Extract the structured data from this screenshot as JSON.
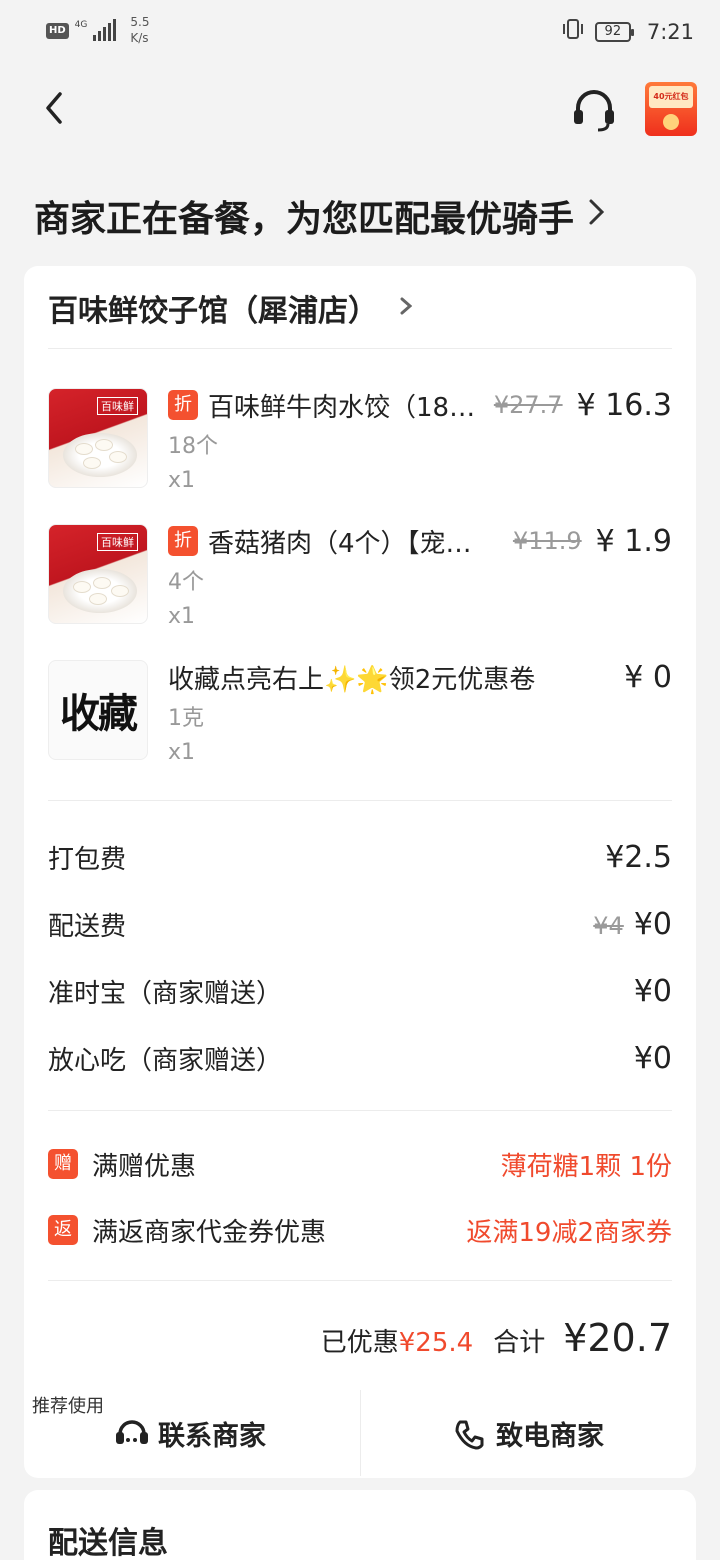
{
  "statusbar": {
    "hd": "HD",
    "network": "4G",
    "speed_value": "5.5",
    "speed_unit": "K/s",
    "battery": "92",
    "time": "7:21"
  },
  "nav": {
    "redpacket_text": "40元红包"
  },
  "order_status": "商家正在备餐，为您匹配最优骑手",
  "shop": {
    "name": "百味鲜饺子馆（犀浦店）"
  },
  "items": [
    {
      "badge": "折",
      "name": "百味鲜牛肉水饺（18…",
      "orig_price": "¥27.7",
      "price": "¥ 16.3",
      "spec": "18个",
      "qty": "x1",
      "thumb_brand": "百味鲜"
    },
    {
      "badge": "折",
      "name": "香菇猪肉（4个）【宠…",
      "orig_price": "¥11.9",
      "price": "¥ 1.9",
      "spec": "4个",
      "qty": "x1",
      "thumb_brand": "百味鲜"
    },
    {
      "name": "收藏点亮右上✨🌟领2元优惠卷",
      "price": "¥ 0",
      "spec": "1克",
      "qty": "x1",
      "thumb_text": "收藏"
    }
  ],
  "fees": [
    {
      "label": "打包费",
      "value": "¥2.5"
    },
    {
      "label": "配送费",
      "orig": "¥4",
      "value": "¥0"
    },
    {
      "label": "准时宝（商家赠送）",
      "value": "¥0"
    },
    {
      "label": "放心吃（商家赠送）",
      "value": "¥0"
    }
  ],
  "promos": [
    {
      "badge": "赠",
      "label": "满赠优惠",
      "value": "薄荷糖1颗 1份"
    },
    {
      "badge": "返",
      "label": "满返商家代金券优惠",
      "value": "返满19减2商家券"
    }
  ],
  "summary": {
    "saved_label": "已优惠",
    "saved_value": "¥25.4",
    "total_label": "合计",
    "total_value": "¥20.7"
  },
  "contact": {
    "recommend": "推荐使用",
    "chat_label": "联系商家",
    "call_label": "致电商家"
  },
  "delivery": {
    "title": "配送信息"
  },
  "colors": {
    "accent": "#f04a2d",
    "badge": "#f4512f",
    "background": "#f3f3f3"
  }
}
